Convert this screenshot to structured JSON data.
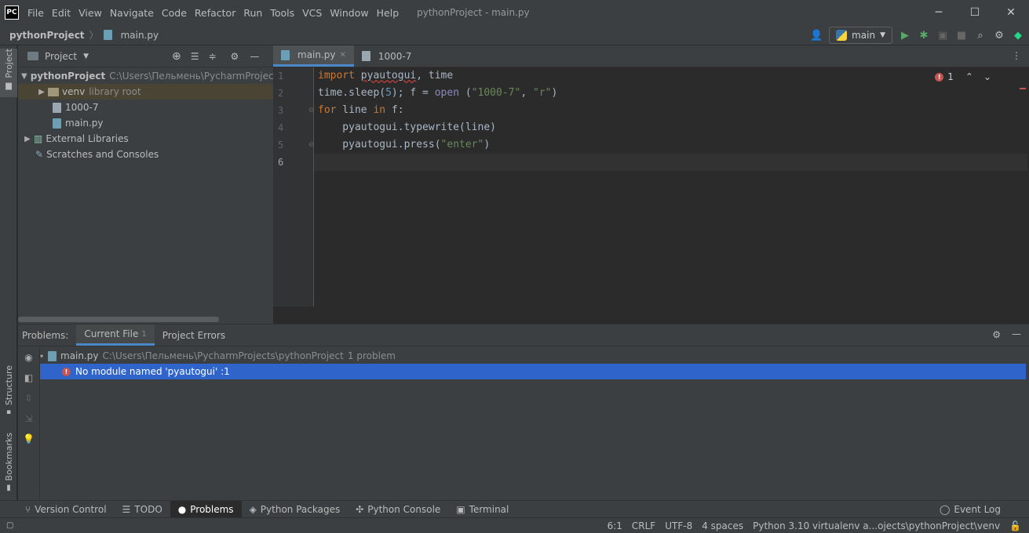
{
  "menu": [
    "File",
    "Edit",
    "View",
    "Navigate",
    "Code",
    "Refactor",
    "Run",
    "Tools",
    "VCS",
    "Window",
    "Help"
  ],
  "window_title": "pythonProject - main.py",
  "logo": "PC",
  "breadcrumb": {
    "project": "pythonProject",
    "file": "main.py"
  },
  "run_config": "main",
  "left_strip": {
    "project": "Project",
    "structure": "Structure",
    "bookmarks": "Bookmarks"
  },
  "project_panel": {
    "title": "Project",
    "root": {
      "name": "pythonProject",
      "path": "C:\\Users\\Пельмень\\PycharmProjects"
    },
    "venv": {
      "name": "venv",
      "note": "library root"
    },
    "files": [
      "1000-7",
      "main.py"
    ],
    "external": "External Libraries",
    "scratches": "Scratches and Consoles"
  },
  "editor": {
    "tabs": [
      "main.py",
      "1000-7"
    ],
    "line_numbers": [
      "1",
      "2",
      "3",
      "4",
      "5",
      "6"
    ],
    "error_count": "1"
  },
  "problems": {
    "label": "Problems:",
    "tabs": [
      {
        "label": "Current File",
        "count": "1"
      },
      {
        "label": "Project Errors"
      }
    ],
    "file": {
      "name": "main.py",
      "path": "C:\\Users\\Пельмень\\PycharmProjects\\pythonProject",
      "summary": "1 problem"
    },
    "error": "No module named 'pyautogui' :1"
  },
  "bottom_tools": [
    "Version Control",
    "TODO",
    "Problems",
    "Python Packages",
    "Python Console",
    "Terminal"
  ],
  "event_log": "Event Log",
  "status": {
    "position": "6:1",
    "line_sep": "CRLF",
    "encoding": "UTF-8",
    "indent": "4 spaces",
    "interpreter": "Python 3.10 virtualenv a...ojects\\pythonProject\\venv"
  }
}
